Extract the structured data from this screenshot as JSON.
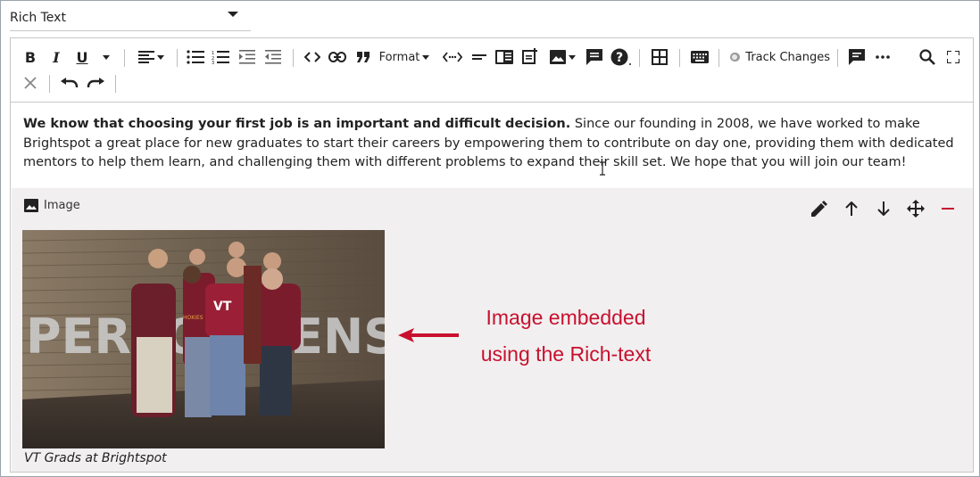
{
  "field": {
    "selected": "Rich Text"
  },
  "toolbar": {
    "bold": "B",
    "italic": "I",
    "underline": "U",
    "format_label": "Format",
    "track_changes_label": "Track Changes"
  },
  "content": {
    "bold_lead": "We know that choosing your first job is an important and difficult decision.",
    "body": " Since our founding in 2008, we have worked to make Brightspot a great place for new graduates to start their careers by empowering them to contribute on day one, providing them with dedicated mentors to help them learn, and challenging them with different problems to expand their skill set. We hope that you will join our team!"
  },
  "embed": {
    "type_label": "Image",
    "caption": "VT Grads at Brightspot",
    "photo_wall_text": "PERFORMENSE",
    "shirt_text": "VT",
    "shirt_text_2": "HOKIES"
  },
  "annotation": {
    "line1": "Image embedded",
    "line2": "using the Rich-text",
    "color": "#c8102e"
  },
  "icons": [
    "bold",
    "italic",
    "underline",
    "chevron-down",
    "align-left",
    "bulleted-list",
    "numbered-list",
    "indent",
    "outdent",
    "code",
    "link",
    "quote",
    "html-code",
    "horizontal-rule",
    "sidebar",
    "add-note",
    "image",
    "comment",
    "help",
    "table",
    "keyboard",
    "track-changes-toggle",
    "comments",
    "more",
    "search",
    "fullscreen",
    "clear",
    "undo",
    "redo",
    "pencil",
    "arrow-up",
    "arrow-down",
    "move",
    "remove"
  ]
}
